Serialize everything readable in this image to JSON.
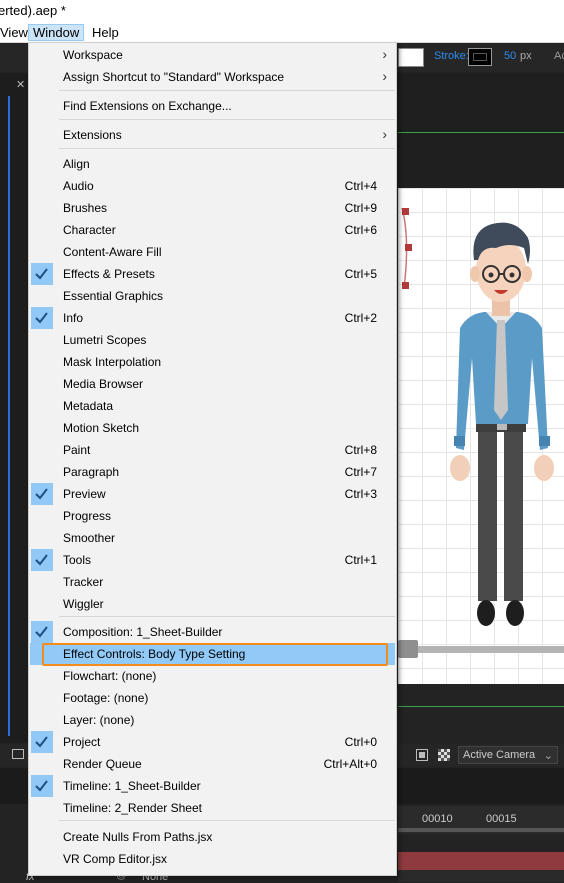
{
  "window_title": "erted).aep *",
  "menubar": {
    "view": "View",
    "window": "Window",
    "help": "Help"
  },
  "toolbar": {
    "stroke_label": "Stroke:",
    "stroke_value": "50",
    "stroke_unit": "px",
    "cut_text": "Ac"
  },
  "viewer": {
    "camera": "Active Camera"
  },
  "timeline": {
    "ruler": [
      "00010",
      "00015"
    ],
    "parent_value": "None",
    "fx_label": "fx"
  },
  "menu": {
    "items": [
      {
        "label": "Workspace",
        "shortcut": "",
        "submenu": true,
        "checked": false
      },
      {
        "label": "Assign Shortcut to \"Standard\" Workspace",
        "shortcut": "",
        "submenu": true,
        "checked": false
      },
      {
        "label": "Find Extensions on Exchange...",
        "shortcut": "",
        "submenu": false,
        "checked": false
      },
      {
        "label": "Extensions",
        "shortcut": "",
        "submenu": true,
        "checked": false
      },
      {
        "label": "Align",
        "shortcut": "",
        "submenu": false,
        "checked": false
      },
      {
        "label": "Audio",
        "shortcut": "Ctrl+4",
        "submenu": false,
        "checked": false
      },
      {
        "label": "Brushes",
        "shortcut": "Ctrl+9",
        "submenu": false,
        "checked": false
      },
      {
        "label": "Character",
        "shortcut": "Ctrl+6",
        "submenu": false,
        "checked": false
      },
      {
        "label": "Content-Aware Fill",
        "shortcut": "",
        "submenu": false,
        "checked": false
      },
      {
        "label": "Effects & Presets",
        "shortcut": "Ctrl+5",
        "submenu": false,
        "checked": true
      },
      {
        "label": "Essential Graphics",
        "shortcut": "",
        "submenu": false,
        "checked": false
      },
      {
        "label": "Info",
        "shortcut": "Ctrl+2",
        "submenu": false,
        "checked": true
      },
      {
        "label": "Lumetri Scopes",
        "shortcut": "",
        "submenu": false,
        "checked": false
      },
      {
        "label": "Mask Interpolation",
        "shortcut": "",
        "submenu": false,
        "checked": false
      },
      {
        "label": "Media Browser",
        "shortcut": "",
        "submenu": false,
        "checked": false
      },
      {
        "label": "Metadata",
        "shortcut": "",
        "submenu": false,
        "checked": false
      },
      {
        "label": "Motion Sketch",
        "shortcut": "",
        "submenu": false,
        "checked": false
      },
      {
        "label": "Paint",
        "shortcut": "Ctrl+8",
        "submenu": false,
        "checked": false
      },
      {
        "label": "Paragraph",
        "shortcut": "Ctrl+7",
        "submenu": false,
        "checked": false
      },
      {
        "label": "Preview",
        "shortcut": "Ctrl+3",
        "submenu": false,
        "checked": true
      },
      {
        "label": "Progress",
        "shortcut": "",
        "submenu": false,
        "checked": false
      },
      {
        "label": "Smoother",
        "shortcut": "",
        "submenu": false,
        "checked": false
      },
      {
        "label": "Tools",
        "shortcut": "Ctrl+1",
        "submenu": false,
        "checked": true
      },
      {
        "label": "Tracker",
        "shortcut": "",
        "submenu": false,
        "checked": false
      },
      {
        "label": "Wiggler",
        "shortcut": "",
        "submenu": false,
        "checked": false
      },
      {
        "label": "Composition: 1_Sheet-Builder",
        "shortcut": "",
        "submenu": false,
        "checked": true
      },
      {
        "label": "Effect Controls: Body Type Setting",
        "shortcut": "",
        "submenu": false,
        "checked": false,
        "highlighted": true
      },
      {
        "label": "Flowchart: (none)",
        "shortcut": "",
        "submenu": false,
        "checked": false
      },
      {
        "label": "Footage: (none)",
        "shortcut": "",
        "submenu": false,
        "checked": false
      },
      {
        "label": "Layer: (none)",
        "shortcut": "",
        "submenu": false,
        "checked": false
      },
      {
        "label": "Project",
        "shortcut": "Ctrl+0",
        "submenu": false,
        "checked": true
      },
      {
        "label": "Render Queue",
        "shortcut": "Ctrl+Alt+0",
        "submenu": false,
        "checked": false
      },
      {
        "label": "Timeline: 1_Sheet-Builder",
        "shortcut": "",
        "submenu": false,
        "checked": true
      },
      {
        "label": "Timeline: 2_Render Sheet",
        "shortcut": "",
        "submenu": false,
        "checked": false
      },
      {
        "label": "Create Nulls From Paths.jsx",
        "shortcut": "",
        "submenu": false,
        "checked": false
      },
      {
        "label": "VR Comp Editor.jsx",
        "shortcut": "",
        "submenu": false,
        "checked": false
      }
    ]
  },
  "colors": {
    "highlight_outline": "#f28c1c",
    "check_bg": "#90c8f6",
    "selection": "#91c9f7"
  }
}
